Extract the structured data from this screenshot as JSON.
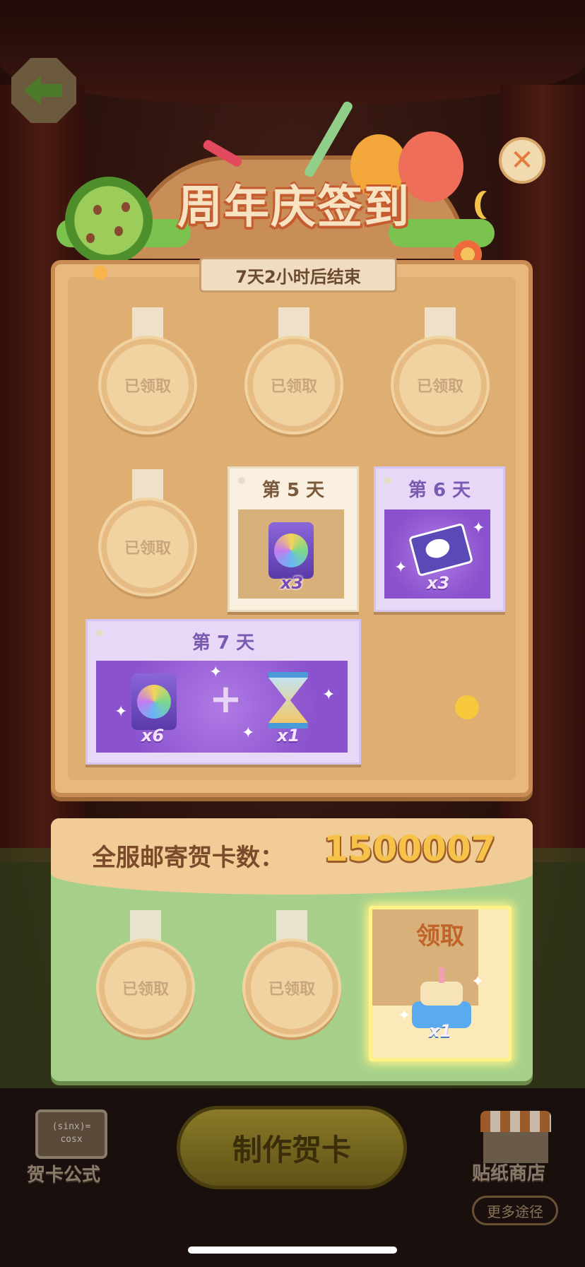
{
  "title": "周年庆签到",
  "timer": "7天2小时后结束",
  "claimed_label": "已领取",
  "days": {
    "day5": {
      "title": "第 5 天",
      "qty": "x3",
      "item_icon": "sticker-coin-pack-icon"
    },
    "day6": {
      "title": "第 6 天",
      "qty": "x3",
      "item_icon": "photo-cards-icon"
    },
    "day7": {
      "title": "第 7 天",
      "qty1": "x6",
      "qty2": "x1",
      "item1_icon": "sticker-coin-pack-icon",
      "item2_icon": "hourglass-icon"
    }
  },
  "mail": {
    "label": "全服邮寄贺卡数：",
    "count": "1500007"
  },
  "claim": {
    "label": "领取",
    "qty": "x1",
    "item_icon": "birthday-cake-icon"
  },
  "bottom_nav": {
    "formula_board": "(sinx)=\ncosx",
    "formula_label": "贺卡公式",
    "make_card_label": "制作贺卡",
    "shop_label": "贴纸商店",
    "more_label": "更多途径"
  },
  "colors": {
    "panel": "#e8b97f",
    "accent_purple": "#8a52cc",
    "claim_glow": "#fff388",
    "count_gold": "#f6c24a"
  }
}
